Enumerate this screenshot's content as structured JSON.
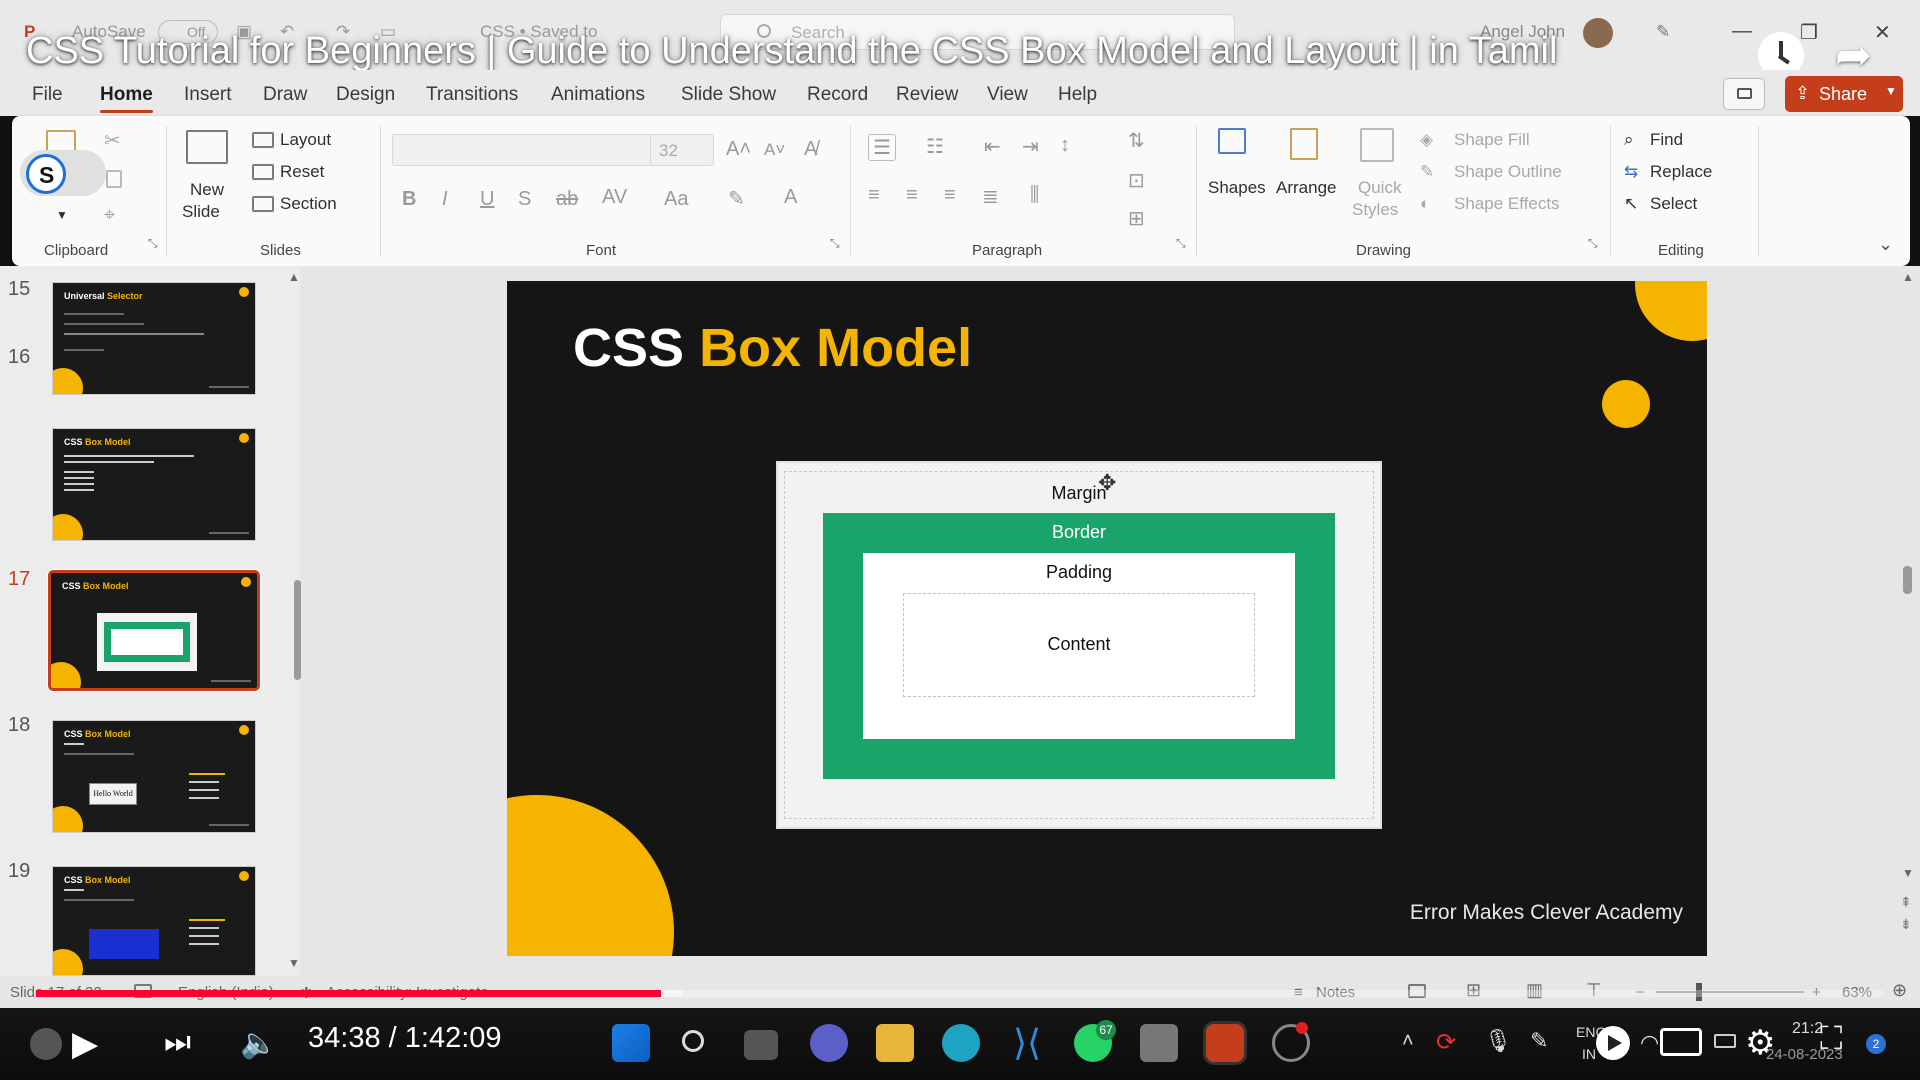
{
  "titlebar": {
    "autosave": "AutoSave",
    "autosave_state": "Off",
    "filename": "CSS • Saved to",
    "search_placeholder": "Search",
    "user": "Angel John"
  },
  "video": {
    "title": "CSS Tutorial for Beginners | Guide to Understand the CSS Box Model and Layout | in Tamil",
    "time_current": "34:38",
    "time_separator": "/",
    "time_total": "1:42:09",
    "progress": 0.338,
    "buffered": 0.35
  },
  "menu": {
    "tabs": [
      "File",
      "Home",
      "Insert",
      "Draw",
      "Design",
      "Transitions",
      "Animations",
      "Slide Show",
      "Record",
      "Review",
      "View",
      "Help"
    ],
    "active_tab": "Home",
    "share_label": "Share"
  },
  "ribbon": {
    "slides": {
      "new_slide": "New",
      "new_slide2": "Slide",
      "layout": "Layout",
      "reset": "Reset",
      "section": "Section"
    },
    "font": {
      "size": "32"
    },
    "drawing": {
      "shapes": "Shapes",
      "arrange": "Arrange",
      "quick": "Quick",
      "styles": "Styles",
      "shape_fill": "Shape Fill",
      "shape_outline": "Shape Outline",
      "shape_effects": "Shape Effects"
    },
    "editing": {
      "find": "Find",
      "replace": "Replace",
      "select": "Select"
    },
    "groups": [
      "Clipboard",
      "Slides",
      "Font",
      "Paragraph",
      "Drawing",
      "Editing"
    ]
  },
  "thumbnails": [
    {
      "num": "15",
      "title_plain": "Universal ",
      "title_acc": "Selector"
    },
    {
      "num": "16",
      "title_plain": "CSS ",
      "title_acc": "Box Model"
    },
    {
      "num": "17",
      "title_plain": "CSS ",
      "title_acc": "Box Model",
      "active": true
    },
    {
      "num": "18",
      "title_plain": "CSS ",
      "title_acc": "Box Model"
    },
    {
      "num": "19",
      "title_plain": "CSS ",
      "title_acc": "Box Model"
    }
  ],
  "slide": {
    "title_plain": "CSS",
    "title_accent": "Box Model",
    "margin_label": "Margin",
    "border_label": "Border",
    "padding_label": "Padding",
    "content_label": "Content",
    "footer": "Error Makes Clever Academy"
  },
  "status": {
    "slide_info": "Slide 17 of 32",
    "language": "English (India)",
    "accessibility": "Accessibility: Investigate",
    "notes": "Notes",
    "zoom": "63%"
  },
  "tray": {
    "lang_top": "ENG",
    "lang_bottom": "IN",
    "clock_time": "21:2",
    "clock_date": "24-08-2023",
    "whatsapp_count": "67",
    "notif_count": "2"
  },
  "colors": {
    "accent_yellow": "#f4b400",
    "border_green": "#1aa36a",
    "ppt_red": "#c43e1c",
    "yt_red": "#ff0033"
  }
}
